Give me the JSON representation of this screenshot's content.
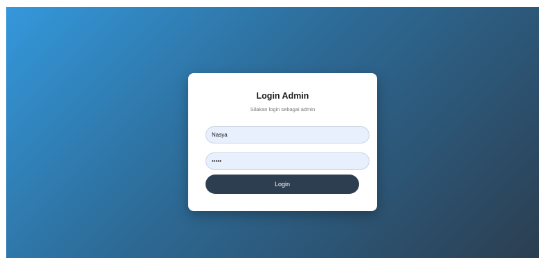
{
  "login": {
    "title": "Login Admin",
    "subtitle": "Silakan login sebagai admin",
    "username_value": "Nasya",
    "password_value": "•••••",
    "button_label": "Login"
  },
  "colors": {
    "gradient_start": "#3498db",
    "gradient_end": "#2c3e50",
    "card_background": "#ffffff",
    "input_background": "#e8f0fe",
    "button_background": "#2c3e50"
  }
}
